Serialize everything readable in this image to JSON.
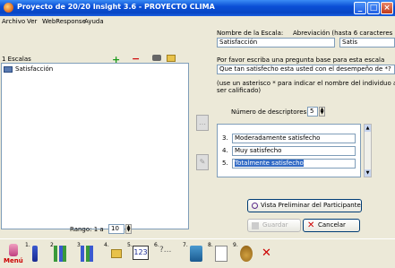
{
  "window": {
    "title": "Proyecto de 20/20 Insight 3.6 - PROYECTO CLIMA"
  },
  "menu": [
    "Archivo",
    "Ver",
    "WebResponse",
    "Ayuda"
  ],
  "left": {
    "header": "1 Escalas",
    "items": [
      "Satisfacción"
    ],
    "rango_label": "Rango: 1 a",
    "rango_value": "10"
  },
  "right": {
    "scale_name_label": "Nombre de la Escala:",
    "abbr_label": "Abreviación (hasta 6 caracteres",
    "scale_name_value": "Satisfacción",
    "abbr_value": "Satis",
    "question_prompt": "Por favor escriba una pregunta base para esta escala",
    "question_value": "Que tan satisfecho esta usted con el desempeño de *?",
    "asterisk_note_1": "(use un asterisco * para indicar el nombre del individuo a",
    "asterisk_note_2": "ser calificado)",
    "descriptors_label": "Número de descriptores:",
    "descriptors_value": "5",
    "descriptors": [
      {
        "num": "3.",
        "text": "Moderadamente satisfecho"
      },
      {
        "num": "4.",
        "text": "Muy satisfecho"
      },
      {
        "num": "5.",
        "text": "Totalmente satisfecho"
      }
    ],
    "preview_button": "Vista Preliminar del Participante",
    "save_button": "Guardar",
    "cancel_button": "Cancelar"
  },
  "toolbar": {
    "menu_label": "Menú",
    "numbers": [
      "1.",
      "2.",
      "3.",
      "4.",
      "5.",
      "6.",
      "7.",
      "8.",
      "9."
    ],
    "item5_text": "123"
  },
  "colors": {
    "accent_blue": "#0a4fd6",
    "selection": "#316ac5",
    "plus_green": "#1a9a1a",
    "minus_red": "#d01010"
  }
}
